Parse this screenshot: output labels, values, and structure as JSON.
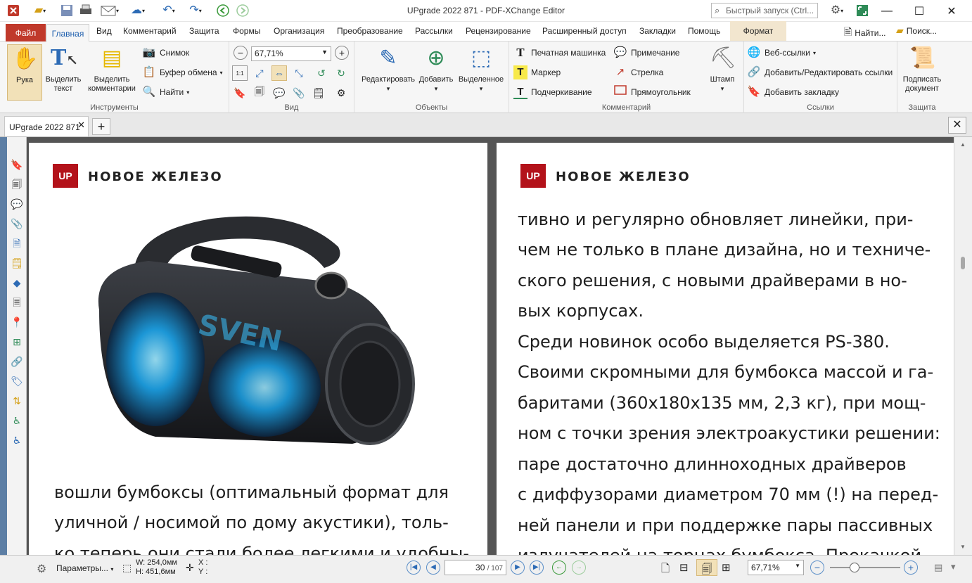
{
  "title": "UPgrade 2022 871 - PDF-XChange Editor",
  "quick_search_placeholder": "Быстрый запуск (Ctrl...",
  "menu": {
    "file": "Файл",
    "home": "Главная",
    "view": "Вид",
    "comment": "Комментарий",
    "protect": "Защита",
    "forms": "Формы",
    "organize": "Организация",
    "convert": "Преобразование",
    "mailings": "Рассылки",
    "review": "Рецензирование",
    "advanced": "Расширенный доступ",
    "bookmarks": "Закладки",
    "help": "Помощь",
    "format": "Формат",
    "find": "Найти...",
    "search": "Поиск..."
  },
  "ribbon": {
    "tools": {
      "label": "Инструменты",
      "hand": "Рука",
      "select_text": "Выделить\nтекст",
      "select_comments": "Выделить\nкомментарии",
      "snapshot": "Снимок",
      "clipboard": "Буфер обмена",
      "find": "Найти"
    },
    "view": {
      "label": "Вид",
      "zoom": "67,71%"
    },
    "objects": {
      "label": "Объекты",
      "edit": "Редактировать",
      "add": "Добавить",
      "selected": "Выделенное"
    },
    "comments": {
      "label": "Комментарий",
      "typewriter": "Печатная машинка",
      "note": "Примечание",
      "marker": "Маркер",
      "arrow": "Стрелка",
      "underline": "Подчеркивание",
      "rectangle": "Прямоугольник",
      "stamp": "Штамп"
    },
    "links": {
      "label": "Ссылки",
      "web_links": "Веб-ссылки",
      "add_edit_links": "Добавить/Редактировать ссылки",
      "add_bookmark": "Добавить закладку"
    },
    "protect": {
      "label": "Защита",
      "sign": "Подписать\nдокумент"
    }
  },
  "doc_tab": "UPgrade 2022 871",
  "page_left": {
    "logo": "UP",
    "header": "НОВОЕ ЖЕЛЕЗО",
    "product_brand": "SVEN",
    "lines": [
      "вошли бумбоксы (оптимальный формат для",
      "уличной / носимой по дому акустики), толь-",
      "ко теперь они стали более легкими и удобны-"
    ]
  },
  "page_right": {
    "logo": "UP",
    "header": "НОВОЕ ЖЕЛЕЗО",
    "lines": [
      "тивно и регулярно обновляет линейки, при-",
      "чем не только в плане дизайна, но и техниче-",
      "ского решения, с новыми драйверами в но-",
      "вых корпусах.",
      "Среди новинок особо выделяется PS-380.",
      "Своими скромными для бумбокса массой и га-",
      "баритами (360x180x135 мм, 2,3 кг), при мощ-",
      "ном с точки зрения электроакустики решении:",
      "паре достаточно длинноходных драйверов",
      "с диффузорами диаметром 70 мм (!) на перед-",
      "ней панели и при поддержке пары пассивных",
      "излучателей на торцах бумбокса. Прокачкой"
    ]
  },
  "status": {
    "params": "Параметры...",
    "width": "W: 254,0мм",
    "height": "H: 451,6мм",
    "x": "X :",
    "y": "Y :",
    "page_current": "30",
    "page_total": "/ 107",
    "zoom": "67,71%"
  }
}
